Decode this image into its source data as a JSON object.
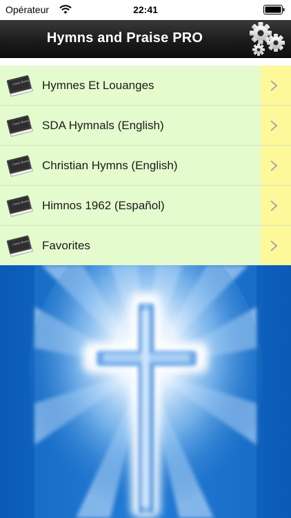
{
  "status_bar": {
    "carrier": "Opérateur",
    "time": "22:41",
    "wifi_icon": "wifi-icon",
    "battery_icon": "battery-icon"
  },
  "nav": {
    "title": "Hymns and Praise PRO",
    "settings_icon": "gears-icon"
  },
  "menu": {
    "items": [
      {
        "label": "Hymnes Et Louanges",
        "icon": "book-icon"
      },
      {
        "label": "SDA Hymnals (English)",
        "icon": "book-icon"
      },
      {
        "label": "Christian Hymns (English)",
        "icon": "book-icon"
      },
      {
        "label": "Himnos 1962 (Español)",
        "icon": "book-icon"
      },
      {
        "label": "Favorites",
        "icon": "book-icon"
      }
    ],
    "book_cover_text": "Classic Hymns"
  },
  "colors": {
    "row_background": "#e4fbcd",
    "chevron_cell": "#fdf89a",
    "nav_background": "#1c1c1c",
    "image_blue": "#0b5cb8"
  },
  "image": {
    "subject": "cross-image"
  }
}
